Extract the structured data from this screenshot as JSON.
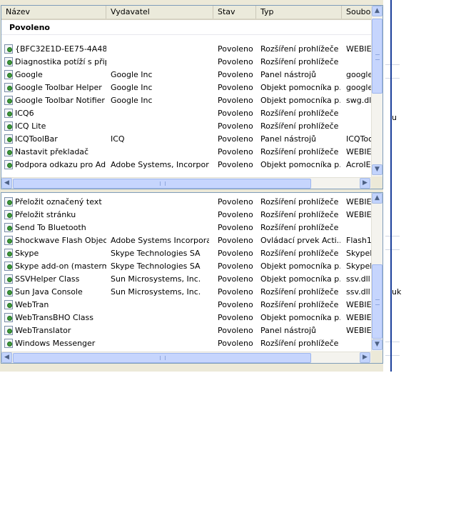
{
  "columns": [
    "Název",
    "Vydavatel",
    "Stav",
    "Typ",
    "Soubo"
  ],
  "group_title": "Povoleno",
  "list_top": [
    {
      "name": "{BFC32E1D-EE75-4A48...",
      "publisher": "",
      "status": "Povoleno",
      "type": "Rozšíření prohlížeče",
      "file": "WEBIE"
    },
    {
      "name": "Diagnostika potíží s přip...",
      "publisher": "",
      "status": "Povoleno",
      "type": "Rozšíření prohlížeče",
      "file": ""
    },
    {
      "name": "Google",
      "publisher": "Google Inc",
      "status": "Povoleno",
      "type": "Panel nástrojů",
      "file": "googleT"
    },
    {
      "name": "Google Toolbar Helper",
      "publisher": "Google Inc",
      "status": "Povoleno",
      "type": "Objekt pomocníka p...",
      "file": "googleT"
    },
    {
      "name": "Google Toolbar Notifier ...",
      "publisher": "Google Inc",
      "status": "Povoleno",
      "type": "Objekt pomocníka p...",
      "file": "swg.dll"
    },
    {
      "name": "ICQ6",
      "publisher": "",
      "status": "Povoleno",
      "type": "Rozšíření prohlížeče",
      "file": ""
    },
    {
      "name": "ICQ Lite",
      "publisher": "",
      "status": "Povoleno",
      "type": "Rozšíření prohlížeče",
      "file": ""
    },
    {
      "name": "ICQToolBar",
      "publisher": "ICQ",
      "status": "Povoleno",
      "type": "Panel nástrojů",
      "file": "ICQToo"
    },
    {
      "name": "Nastavit překladač",
      "publisher": "",
      "status": "Povoleno",
      "type": "Rozšíření prohlížeče",
      "file": "WEBIE"
    },
    {
      "name": "Podpora odkazu pro Ad...",
      "publisher": "Adobe Systems, Incorpor...",
      "status": "Povoleno",
      "type": "Objekt pomocníka p...",
      "file": "AcroIE"
    }
  ],
  "list_bottom": [
    {
      "name": "Přeložit označený text",
      "publisher": "",
      "status": "Povoleno",
      "type": "Rozšíření prohlížeče",
      "file": "WEBIE"
    },
    {
      "name": "Přeložit stránku",
      "publisher": "",
      "status": "Povoleno",
      "type": "Rozšíření prohlížeče",
      "file": "WEBIE"
    },
    {
      "name": "Send To Bluetooth",
      "publisher": "",
      "status": "Povoleno",
      "type": "Rozšíření prohlížeče",
      "file": ""
    },
    {
      "name": "Shockwave Flash Object",
      "publisher": "Adobe Systems Incorpora...",
      "status": "Povoleno",
      "type": "Ovládací prvek Acti...",
      "file": "Flash1("
    },
    {
      "name": "Skype",
      "publisher": "Skype Technologies SA",
      "status": "Povoleno",
      "type": "Rozšíření prohlížeče",
      "file": "SkypeI"
    },
    {
      "name": "Skype add-on (masterm...",
      "publisher": "Skype Technologies SA",
      "status": "Povoleno",
      "type": "Objekt pomocníka p...",
      "file": "SkypeI"
    },
    {
      "name": "SSVHelper Class",
      "publisher": "Sun Microsystems, Inc.",
      "status": "Povoleno",
      "type": "Objekt pomocníka p...",
      "file": "ssv.dll"
    },
    {
      "name": "Sun Java Console",
      "publisher": "Sun Microsystems, Inc.",
      "status": "Povoleno",
      "type": "Rozšíření prohlížeče",
      "file": "ssv.dll"
    },
    {
      "name": "WebTran",
      "publisher": "",
      "status": "Povoleno",
      "type": "Rozšíření prohlížeče",
      "file": "WEBIE"
    },
    {
      "name": "WebTransBHO Class",
      "publisher": "",
      "status": "Povoleno",
      "type": "Objekt pomocníka p...",
      "file": "WEBIE"
    },
    {
      "name": "WebTranslator",
      "publisher": "",
      "status": "Povoleno",
      "type": "Panel nástrojů",
      "file": "WEBIE"
    },
    {
      "name": "Windows Messenger",
      "publisher": "",
      "status": "Povoleno",
      "type": "Rozšíření prohlížeče",
      "file": ""
    }
  ],
  "background_fragments": [
    "u",
    "uk"
  ],
  "icons": {
    "addon": "addon-icon",
    "scroll_up": "▲",
    "scroll_down": "▼",
    "scroll_left": "◀",
    "scroll_right": "▶"
  },
  "colors": {
    "header_bg": "#ebeadb",
    "border": "#7f9db9",
    "scroll": "#c2d3fc",
    "frame_accent": "#1b3f9a"
  }
}
